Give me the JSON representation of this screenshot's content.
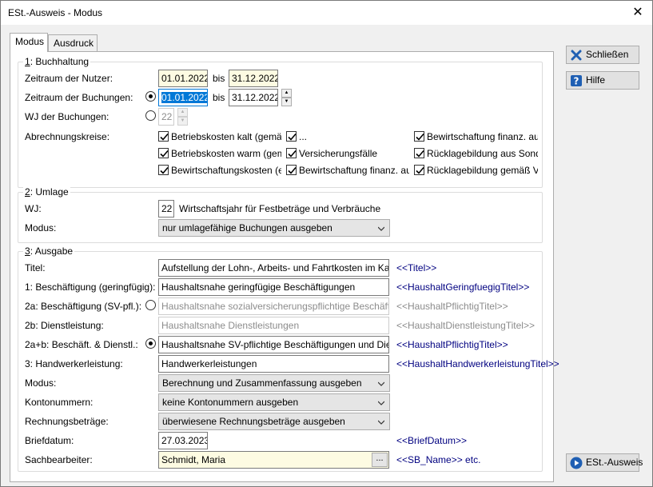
{
  "window": {
    "title": "ESt.-Ausweis - Modus",
    "close_glyph": "✕"
  },
  "tabs": [
    {
      "label": "Modus"
    },
    {
      "label": "Ausdruck"
    }
  ],
  "buchhaltung": {
    "title_num": "1",
    "title_rest": ": Buchhaltung",
    "zeitraum_nutzer": {
      "label": "Zeitraum der Nutzer:",
      "from": "01.01.2022",
      "bis": "bis",
      "to": "31.12.2022"
    },
    "zeitraum_buchungen": {
      "label": "Zeitraum der Buchungen:",
      "from": "01.01.2022",
      "bis": "bis",
      "to": "31.12.2022"
    },
    "wj_buchungen": {
      "label": "WJ der Buchungen:",
      "value": "22"
    },
    "abrechnungskreise": {
      "label": "Abrechnungskreise:",
      "items": [
        "Betriebskosten kalt (gemä",
        "...",
        "Bewirtschaftung finanz. au",
        "Betriebskosten warm (gem",
        "Versicherungsfälle",
        "Rücklagebildung aus Sond",
        "Bewirtschaftungskosten (e",
        "Bewirtschaftung finanz. au",
        "Rücklagebildung gemäß V"
      ]
    }
  },
  "umlage": {
    "title_num": "2",
    "title_rest": ": Umlage",
    "wj": {
      "label": "WJ:",
      "value": "22",
      "desc": "Wirtschaftsjahr für Festbeträge und Verbräuche"
    },
    "modus": {
      "label": "Modus:",
      "value": "nur umlagefähige Buchungen ausgeben"
    }
  },
  "ausgabe": {
    "title_num": "3",
    "title_rest": ": Ausgabe",
    "titel": {
      "label": "Titel:",
      "value": "Aufstellung der Lohn-, Arbeits- und Fahrtkosten im Ka",
      "tag": "<<Titel>>"
    },
    "beschaeftigung_gering": {
      "label": "1: Beschäftigung (geringfügig):",
      "value": "Haushaltsnahe geringfügige Beschäftigungen",
      "tag": "<<HaushaltGeringfuegigTitel>>"
    },
    "beschaeftigung_sv": {
      "label": "2a: Beschäftigung (SV-pfl.):",
      "value": "Haushaltsnahe sozialversicherungspflichtige Beschäfti",
      "tag": "<<HaushaltPflichtigTitel>>"
    },
    "dienstleistung": {
      "label": "2b: Dienstleistung:",
      "value": "Haushaltsnahe Dienstleistungen",
      "tag": "<<HaushaltDienstleistungTitel>>"
    },
    "beschaeft_dienstl": {
      "label": "2a+b: Beschäft. & Dienstl.:",
      "value": "Haushaltsnahe SV-pflichtige Beschäftigungen und Die",
      "tag": "<<HaushaltPflichtigTitel>>"
    },
    "handwerker": {
      "label": "3: Handwerkerleistung:",
      "value": "Handwerkerleistungen",
      "tag": "<<HaushaltHandwerkerleistungTitel>>"
    },
    "modus": {
      "label": "Modus:",
      "value": "Berechnung und Zusammenfassung ausgeben"
    },
    "kontonummern": {
      "label": "Kontonummern:",
      "value": "keine Kontonummern ausgeben"
    },
    "rechnungsbetraege": {
      "label": "Rechnungsbeträge:",
      "value": "überwiesene Rechnungsbeträge ausgeben"
    },
    "briefdatum": {
      "label": "Briefdatum:",
      "value": "27.03.2023",
      "tag": "<<BriefDatum>>"
    },
    "sachbearbeiter": {
      "label": "Sachbearbeiter:",
      "value": "Schmidt, Maria",
      "button": "...",
      "tag": "<<SB_Name>> etc."
    }
  },
  "side_buttons": {
    "schliessen": {
      "label": "Schließen"
    },
    "hilfe": {
      "label": "Hilfe"
    },
    "est_ausweis": {
      "label": "ESt.-Ausweis"
    }
  },
  "colors": {
    "tag": "#000080",
    "highlight": "#0078d7",
    "yellow_field": "#fdfbe2"
  }
}
